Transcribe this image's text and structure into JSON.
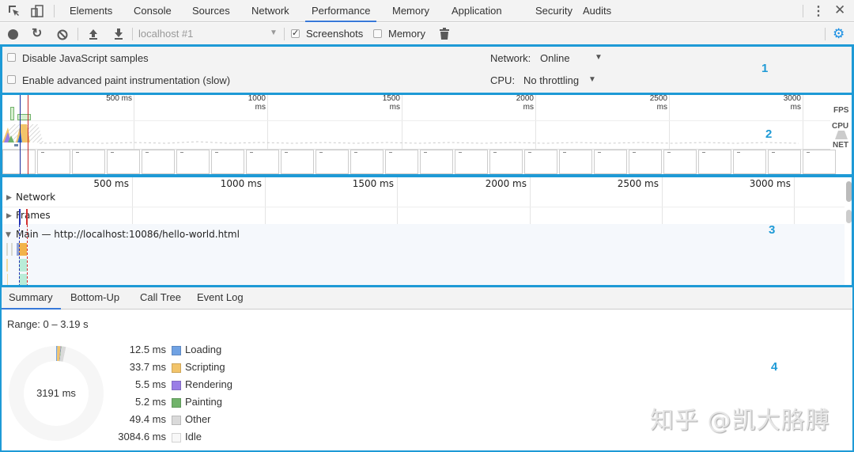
{
  "devtools_tabs": [
    "Elements",
    "Console",
    "Sources",
    "Network",
    "Performance",
    "Memory",
    "Application",
    "Security",
    "Audits"
  ],
  "active_tab": "Performance",
  "toolbar": {
    "record_icon": "record-icon",
    "reload_icon": "reload-icon",
    "clear_icon": "clear-icon",
    "upload_icon": "load-profile-icon",
    "download_icon": "save-profile-icon",
    "profile_select": "localhost #1",
    "screenshots_label": "Screenshots",
    "screenshots_checked": true,
    "memory_label": "Memory",
    "memory_checked": false,
    "trash_icon": "trash-icon",
    "settings_icon": "gear-icon",
    "accent": "#1a8fe3"
  },
  "settings": {
    "disable_js_samples": "Disable JavaScript samples",
    "enable_paint": "Enable advanced paint instrumentation (slow)",
    "network_label": "Network:",
    "network_value": "Online",
    "cpu_label": "CPU:",
    "cpu_value": "No throttling"
  },
  "annotations": [
    "1",
    "2",
    "3",
    "4"
  ],
  "overview": {
    "ticks": [
      "500 ms",
      "1000 ms",
      "1500 ms",
      "2000 ms",
      "2500 ms",
      "3000 ms"
    ],
    "side_labels": [
      "FPS",
      "CPU",
      "NET"
    ]
  },
  "flame": {
    "ticks": [
      "500 ms",
      "1000 ms",
      "1500 ms",
      "2000 ms",
      "2500 ms",
      "3000 ms"
    ],
    "tracks": {
      "network": "Network",
      "frames": "Frames",
      "main": "Main — http://localhost:10086/hello-world.html"
    }
  },
  "bottom_tabs": [
    "Summary",
    "Bottom-Up",
    "Call Tree",
    "Event Log"
  ],
  "summary": {
    "range": "Range: 0 – 3.19 s",
    "total": "3191 ms",
    "categories": [
      {
        "value": "12.5 ms",
        "name": "Loading",
        "color": "#70a2e3",
        "ms": 12.5
      },
      {
        "value": "33.7 ms",
        "name": "Scripting",
        "color": "#f2c46a",
        "ms": 33.7
      },
      {
        "value": "5.5 ms",
        "name": "Rendering",
        "color": "#9a7ee6",
        "ms": 5.5
      },
      {
        "value": "5.2 ms",
        "name": "Painting",
        "color": "#71b36b",
        "ms": 5.2
      },
      {
        "value": "49.4 ms",
        "name": "Other",
        "color": "#dadada",
        "ms": 49.4
      },
      {
        "value": "3084.6 ms",
        "name": "Idle",
        "color": "#f8f8f8",
        "ms": 3084.6
      }
    ]
  },
  "watermark": "知乎 @凯大胳膊"
}
